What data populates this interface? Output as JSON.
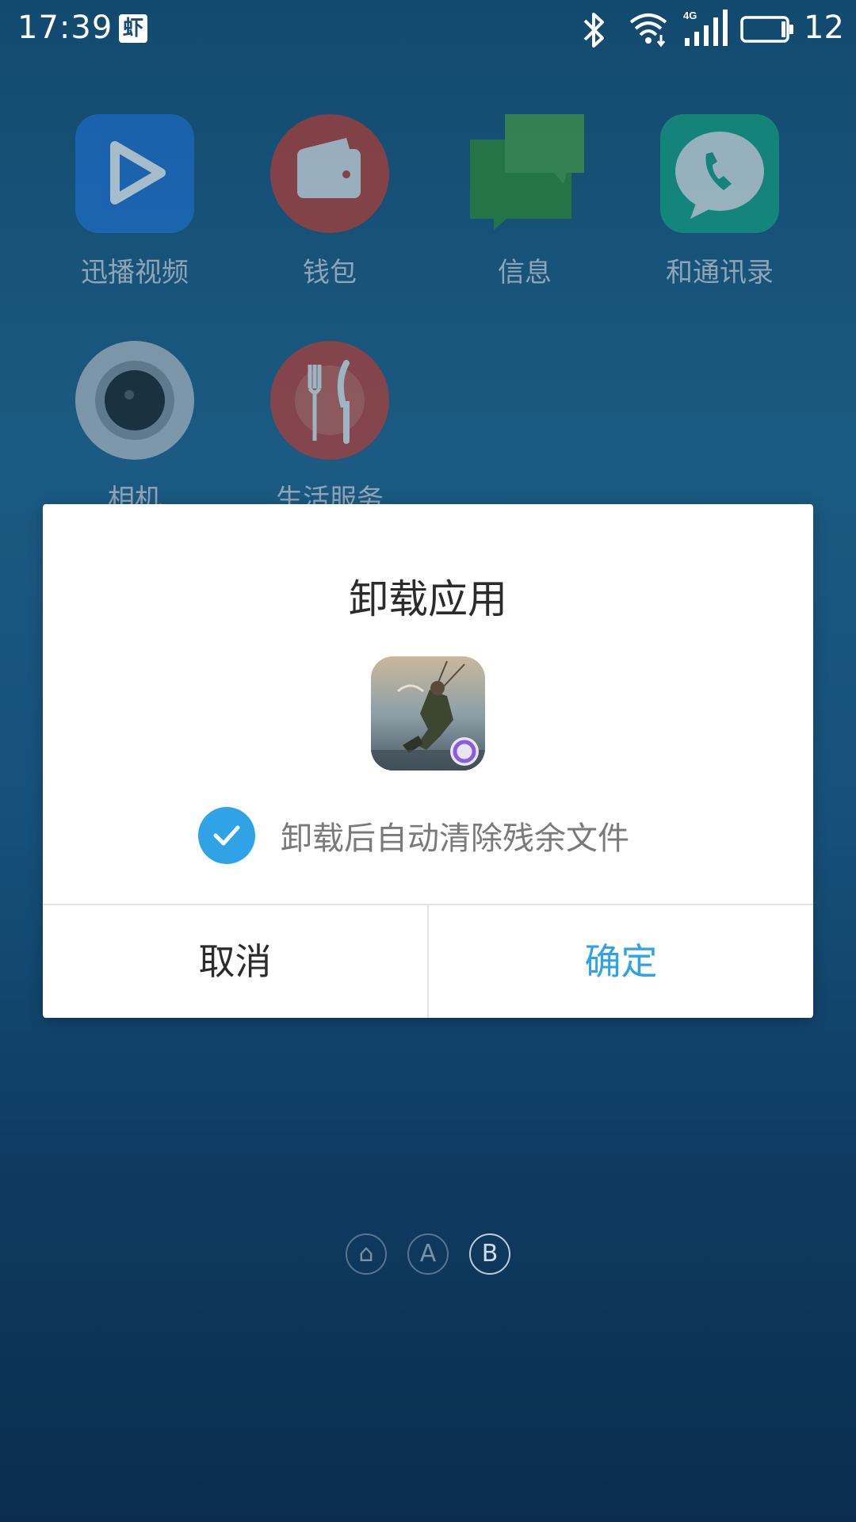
{
  "status_bar": {
    "time": "17:39",
    "notification_icon_text": "虾",
    "network_type": "4G",
    "battery_level": "12"
  },
  "home_apps": [
    {
      "label": "迅播视频",
      "icon": "play-icon"
    },
    {
      "label": "钱包",
      "icon": "wallet-icon"
    },
    {
      "label": "信息",
      "icon": "chat-bubbles-icon"
    },
    {
      "label": "和通讯录",
      "icon": "phone-bubble-icon"
    },
    {
      "label": "相机",
      "icon": "camera-icon"
    },
    {
      "label": "生活服务",
      "icon": "fork-knife-icon"
    }
  ],
  "page_indicator": [
    "⌂",
    "A",
    "B"
  ],
  "dialog": {
    "title": "卸载应用",
    "app_icon": "game-app-icon",
    "checkbox_label": "卸载后自动清除残余文件",
    "checkbox_checked": true,
    "cancel_label": "取消",
    "confirm_label": "确定"
  },
  "colors": {
    "accent": "#2fa3e6",
    "dialog_bg": "#ffffff",
    "wallpaper": "#1b5a82"
  }
}
